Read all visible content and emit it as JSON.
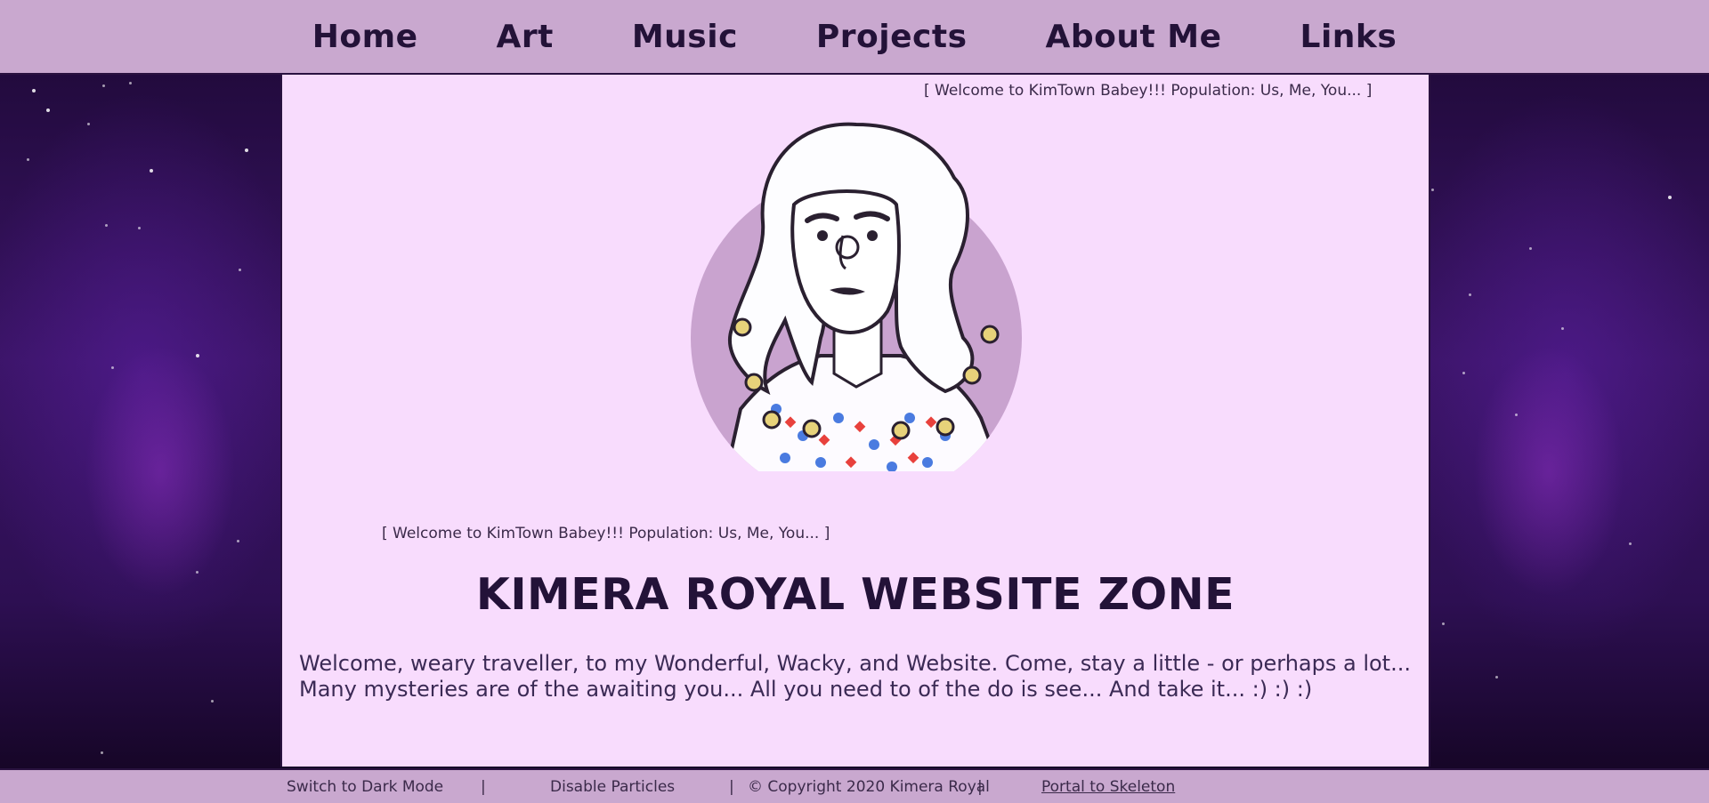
{
  "nav": {
    "items": [
      {
        "label": "Home"
      },
      {
        "label": "Art"
      },
      {
        "label": "Music"
      },
      {
        "label": "Projects"
      },
      {
        "label": "About Me"
      },
      {
        "label": "Links"
      }
    ]
  },
  "main": {
    "tagline_top": "[ Welcome to KimTown Babey!!! Population: Us, Me, You... ]",
    "tagline_mid": "[ Welcome to KimTown Babey!!! Population: Us, Me, You... ]",
    "title": "KIMERA ROYAL WEBSITE ZONE",
    "intro": "Welcome, weary traveller, to my Wonderful, Wacky, and Website. Come, stay a little - or perhaps a lot... Many mysteries are of the awaiting you... All you need to of the do is see... And take it... :) :) :)"
  },
  "footer": {
    "dark_mode": "Switch to Dark Mode",
    "sep1": "|",
    "particles": "Disable Particles",
    "sep2": "|",
    "copyright": "© Copyright 2020 Kimera Royal",
    "sep3": "|",
    "portal": "Portal to Skeleton"
  },
  "colors": {
    "nav_bg": "#c9a8cf",
    "panel_bg": "#f8dcfd",
    "text_dark": "#231238",
    "background": "#2a0f45"
  }
}
